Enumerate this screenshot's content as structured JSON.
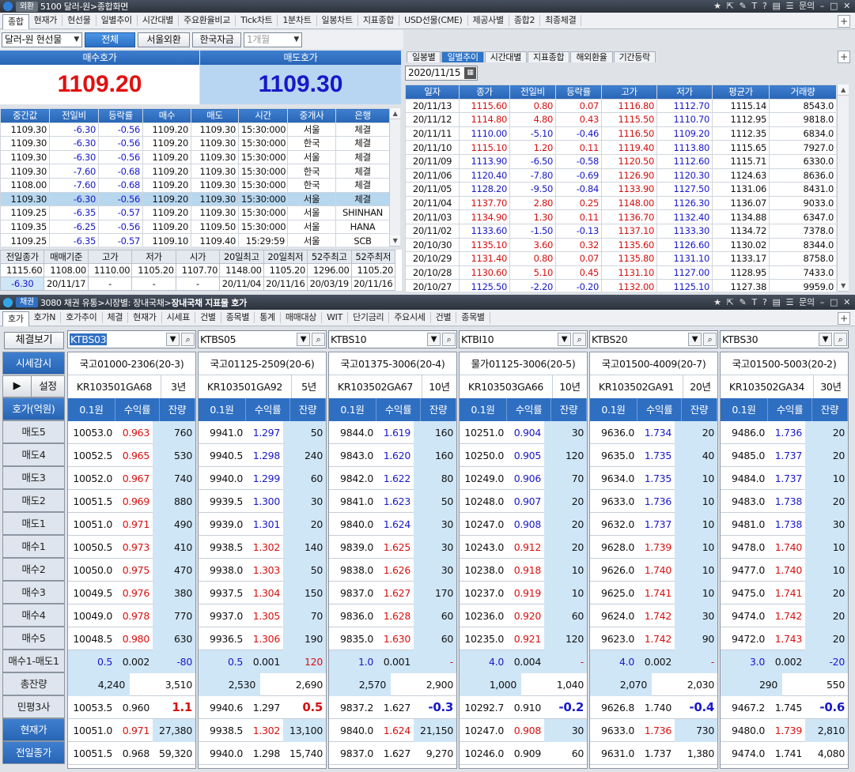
{
  "fx_window": {
    "badge": "외환",
    "title": "5100 달러-원>종합화면",
    "controls": [
      "★",
      "⇱",
      "✎",
      "T",
      "?",
      "▤",
      "☰",
      "문의",
      "–",
      "□",
      "✕"
    ],
    "tabs": [
      "종합",
      "현재가",
      "현선물",
      "일별추이",
      "시간대별",
      "주요환율비교",
      "Tick차트",
      "1분차트",
      "일봉차트",
      "지표종합",
      "USD선물(CME)",
      "제공사별",
      "종합2",
      "최종체결"
    ],
    "active_tab": 0,
    "instrument": "달러-원 현선물",
    "filters": [
      "전체",
      "서울외환",
      "한국자금"
    ],
    "period": "1개월",
    "bid_label": "매수호가",
    "ask_label": "매도호가",
    "bid_value": "1109.20",
    "ask_value": "1109.30",
    "tick_headers": [
      "중간값",
      "전일비",
      "등락률",
      "매수",
      "매도",
      "시간",
      "중개사",
      "은행"
    ],
    "ticks": [
      [
        "1109.30",
        "-6.30",
        "-0.56",
        "1109.20",
        "1109.30",
        "15:30:000",
        "서울",
        "체결"
      ],
      [
        "1109.30",
        "-6.30",
        "-0.56",
        "1109.20",
        "1109.30",
        "15:30:000",
        "한국",
        "체결"
      ],
      [
        "1109.30",
        "-6.30",
        "-0.56",
        "1109.20",
        "1109.30",
        "15:30:000",
        "서울",
        "체결"
      ],
      [
        "1109.30",
        "-7.60",
        "-0.68",
        "1109.20",
        "1109.30",
        "15:30:000",
        "한국",
        "체결"
      ],
      [
        "1108.00",
        "-7.60",
        "-0.68",
        "1109.20",
        "1109.30",
        "15:30:000",
        "한국",
        "체결"
      ],
      [
        "1109.30",
        "-6.30",
        "-0.56",
        "1109.20",
        "1109.30",
        "15:30:000",
        "서울",
        "체결"
      ],
      [
        "1109.25",
        "-6.35",
        "-0.57",
        "1109.20",
        "1109.30",
        "15:30:000",
        "서울",
        "SHINHAN"
      ],
      [
        "1109.35",
        "-6.25",
        "-0.56",
        "1109.20",
        "1109.50",
        "15:30:000",
        "서울",
        "HANA"
      ],
      [
        "1109.25",
        "-6.35",
        "-0.57",
        "1109.10",
        "1109.40",
        "15:29:59",
        "서울",
        "SCB"
      ]
    ],
    "summary_headers": [
      "전일종가",
      "매매기준",
      "고가",
      "저가",
      "시가",
      "20일최고",
      "20일최저",
      "52주최고",
      "52주최저"
    ],
    "summary_row1": [
      "1115.60",
      "1108.00",
      "1110.00",
      "1105.20",
      "1107.70",
      "1148.00",
      "1105.20",
      "1296.00",
      "1105.20"
    ],
    "summary_row2": [
      "-6.30",
      "20/11/17",
      "-",
      "-",
      "-",
      "20/11/04",
      "20/11/16",
      "20/03/19",
      "20/11/16"
    ],
    "right_tabs": [
      "일봉별",
      "일별추이",
      "시간대별",
      "지표종합",
      "해외환율",
      "기간등락"
    ],
    "right_active": 1,
    "date": "2020/11/15",
    "daily_headers": [
      "일자",
      "종가",
      "전일비",
      "등락률",
      "고가",
      "저가",
      "평균가",
      "거래량"
    ],
    "daily": [
      [
        "20/11/13",
        "1115.60",
        "0.80",
        "0.07",
        "1116.80",
        "1112.70",
        "1115.14",
        "8543.0"
      ],
      [
        "20/11/12",
        "1114.80",
        "4.80",
        "0.43",
        "1115.50",
        "1110.70",
        "1112.95",
        "9818.0"
      ],
      [
        "20/11/11",
        "1110.00",
        "-5.10",
        "-0.46",
        "1116.50",
        "1109.20",
        "1112.35",
        "6834.0"
      ],
      [
        "20/11/10",
        "1115.10",
        "1.20",
        "0.11",
        "1119.40",
        "1113.80",
        "1115.65",
        "7927.0"
      ],
      [
        "20/11/09",
        "1113.90",
        "-6.50",
        "-0.58",
        "1120.50",
        "1112.60",
        "1115.71",
        "6330.0"
      ],
      [
        "20/11/06",
        "1120.40",
        "-7.80",
        "-0.69",
        "1126.90",
        "1120.30",
        "1124.63",
        "8636.0"
      ],
      [
        "20/11/05",
        "1128.20",
        "-9.50",
        "-0.84",
        "1133.90",
        "1127.50",
        "1131.06",
        "8431.0"
      ],
      [
        "20/11/04",
        "1137.70",
        "2.80",
        "0.25",
        "1148.00",
        "1126.30",
        "1136.07",
        "9033.0"
      ],
      [
        "20/11/03",
        "1134.90",
        "1.30",
        "0.11",
        "1136.70",
        "1132.40",
        "1134.88",
        "6347.0"
      ],
      [
        "20/11/02",
        "1133.60",
        "-1.50",
        "-0.13",
        "1137.10",
        "1133.30",
        "1134.72",
        "7378.0"
      ],
      [
        "20/10/30",
        "1135.10",
        "3.60",
        "0.32",
        "1135.60",
        "1126.60",
        "1130.02",
        "8344.0"
      ],
      [
        "20/10/29",
        "1131.40",
        "0.80",
        "0.07",
        "1135.80",
        "1131.10",
        "1133.17",
        "8758.0"
      ],
      [
        "20/10/28",
        "1130.60",
        "5.10",
        "0.45",
        "1131.10",
        "1127.00",
        "1128.95",
        "7433.0"
      ],
      [
        "20/10/27",
        "1125.50",
        "-2.20",
        "-0.20",
        "1132.00",
        "1125.10",
        "1127.38",
        "9959.0"
      ]
    ]
  },
  "bond_window": {
    "badge": "채권",
    "title_plain": "3080 채권 유통>시장별: 장내국채>",
    "title_bold": "장내국채 지표물 호가",
    "tabs": [
      "호가",
      "호가N",
      "호가추이",
      "체결",
      "현재가",
      "시세표",
      "건별",
      "종목별",
      "통계",
      "매매대상",
      "WIT",
      "단기금리",
      "주요시세",
      "건별",
      "종목별"
    ],
    "active_tab": 0,
    "view_button": "체결보기",
    "monitor_label": "시세감시",
    "play_label": "▶",
    "settings_label": "설정",
    "unit_label": "호가(억원)",
    "col_headers": [
      "0.1원",
      "수익률",
      "잔량"
    ],
    "row_labels": [
      "매도5",
      "매도4",
      "매도3",
      "매도2",
      "매도1",
      "매수1",
      "매수2",
      "매수3",
      "매수4",
      "매수5"
    ],
    "diff_label": "매수1-매도1",
    "total_label": "총잔량",
    "private_label": "민평3사",
    "current_label": "현재가",
    "prev_label": "전일종가",
    "panels": [
      {
        "code": "KTBS03",
        "name": "국고01000-2306(20-3)",
        "isin": "KR103501GA68",
        "term": "3년",
        "rows": [
          [
            "10053.0",
            "0.963",
            "760"
          ],
          [
            "10052.5",
            "0.965",
            "530"
          ],
          [
            "10052.0",
            "0.967",
            "740"
          ],
          [
            "10051.5",
            "0.969",
            "880"
          ],
          [
            "10051.0",
            "0.971",
            "490"
          ],
          [
            "10050.5",
            "0.973",
            "410"
          ],
          [
            "10050.0",
            "0.975",
            "470"
          ],
          [
            "10049.5",
            "0.976",
            "380"
          ],
          [
            "10049.0",
            "0.978",
            "770"
          ],
          [
            "10048.5",
            "0.980",
            "630"
          ]
        ],
        "diff": [
          "0.5",
          "0.002",
          "-80"
        ],
        "total": [
          "4,240",
          "3,510"
        ],
        "private": [
          "10053.5",
          "0.960",
          "1.1"
        ],
        "current": [
          "10051.0",
          "0.971",
          "27,380"
        ],
        "prev": [
          "10051.5",
          "0.968",
          "59,320"
        ]
      },
      {
        "code": "KTBS05",
        "name": "국고01125-2509(20-6)",
        "isin": "KR103501GA92",
        "term": "5년",
        "rows": [
          [
            "9941.0",
            "1.297",
            "50"
          ],
          [
            "9940.5",
            "1.298",
            "240"
          ],
          [
            "9940.0",
            "1.299",
            "60"
          ],
          [
            "9939.5",
            "1.300",
            "30"
          ],
          [
            "9939.0",
            "1.301",
            "20"
          ],
          [
            "9938.5",
            "1.302",
            "140"
          ],
          [
            "9938.0",
            "1.303",
            "50"
          ],
          [
            "9937.5",
            "1.304",
            "150"
          ],
          [
            "9937.0",
            "1.305",
            "70"
          ],
          [
            "9936.5",
            "1.306",
            "190"
          ]
        ],
        "diff": [
          "0.5",
          "0.001",
          "120"
        ],
        "total": [
          "2,530",
          "2,690"
        ],
        "private": [
          "9940.6",
          "1.297",
          "0.5"
        ],
        "current": [
          "9938.5",
          "1.302",
          "13,100"
        ],
        "prev": [
          "9940.0",
          "1.298",
          "15,740"
        ]
      },
      {
        "code": "KTBS10",
        "name": "국고01375-3006(20-4)",
        "isin": "KR103502GA67",
        "term": "10년",
        "rows": [
          [
            "9844.0",
            "1.619",
            "160"
          ],
          [
            "9843.0",
            "1.620",
            "160"
          ],
          [
            "9842.0",
            "1.622",
            "80"
          ],
          [
            "9841.0",
            "1.623",
            "50"
          ],
          [
            "9840.0",
            "1.624",
            "30"
          ],
          [
            "9839.0",
            "1.625",
            "30"
          ],
          [
            "9838.0",
            "1.626",
            "30"
          ],
          [
            "9837.0",
            "1.627",
            "170"
          ],
          [
            "9836.0",
            "1.628",
            "60"
          ],
          [
            "9835.0",
            "1.630",
            "60"
          ]
        ],
        "diff": [
          "1.0",
          "0.001",
          "-"
        ],
        "total": [
          "2,570",
          "2,900"
        ],
        "private": [
          "9837.2",
          "1.627",
          "-0.3"
        ],
        "current": [
          "9840.0",
          "1.624",
          "21,150"
        ],
        "prev": [
          "9837.0",
          "1.627",
          "9,270"
        ]
      },
      {
        "code": "KTBI10",
        "name": "물가01125-3006(20-5)",
        "isin": "KR103503GA66",
        "term": "10년",
        "rows": [
          [
            "10251.0",
            "0.904",
            "30"
          ],
          [
            "10250.0",
            "0.905",
            "120"
          ],
          [
            "10249.0",
            "0.906",
            "70"
          ],
          [
            "10248.0",
            "0.907",
            "20"
          ],
          [
            "10247.0",
            "0.908",
            "20"
          ],
          [
            "10243.0",
            "0.912",
            "20"
          ],
          [
            "10238.0",
            "0.918",
            "10"
          ],
          [
            "10237.0",
            "0.919",
            "10"
          ],
          [
            "10236.0",
            "0.920",
            "60"
          ],
          [
            "10235.0",
            "0.921",
            "120"
          ]
        ],
        "diff": [
          "4.0",
          "0.004",
          "-"
        ],
        "total": [
          "1,000",
          "1,040"
        ],
        "private": [
          "10292.7",
          "0.910",
          "-0.2"
        ],
        "current": [
          "10247.0",
          "0.908",
          "30"
        ],
        "prev": [
          "10246.0",
          "0.909",
          "60"
        ]
      },
      {
        "code": "KTBS20",
        "name": "국고01500-4009(20-7)",
        "isin": "KR103502GA91",
        "term": "20년",
        "rows": [
          [
            "9636.0",
            "1.734",
            "20"
          ],
          [
            "9635.0",
            "1.735",
            "40"
          ],
          [
            "9634.0",
            "1.735",
            "10"
          ],
          [
            "9633.0",
            "1.736",
            "10"
          ],
          [
            "9632.0",
            "1.737",
            "10"
          ],
          [
            "9628.0",
            "1.739",
            "10"
          ],
          [
            "9626.0",
            "1.740",
            "10"
          ],
          [
            "9625.0",
            "1.741",
            "10"
          ],
          [
            "9624.0",
            "1.742",
            "30"
          ],
          [
            "9623.0",
            "1.742",
            "90"
          ]
        ],
        "diff": [
          "4.0",
          "0.002",
          "-"
        ],
        "total": [
          "2,070",
          "2,030"
        ],
        "private": [
          "9626.8",
          "1.740",
          "-0.4"
        ],
        "current": [
          "9633.0",
          "1.736",
          "730"
        ],
        "prev": [
          "9631.0",
          "1.737",
          "1,380"
        ]
      },
      {
        "code": "KTBS30",
        "name": "국고01500-5003(20-2)",
        "isin": "KR103502GA34",
        "term": "30년",
        "rows": [
          [
            "9486.0",
            "1.736",
            "20"
          ],
          [
            "9485.0",
            "1.737",
            "20"
          ],
          [
            "9484.0",
            "1.737",
            "10"
          ],
          [
            "9483.0",
            "1.738",
            "20"
          ],
          [
            "9481.0",
            "1.738",
            "30"
          ],
          [
            "9478.0",
            "1.740",
            "10"
          ],
          [
            "9477.0",
            "1.740",
            "10"
          ],
          [
            "9475.0",
            "1.741",
            "20"
          ],
          [
            "9474.0",
            "1.742",
            "20"
          ],
          [
            "9472.0",
            "1.743",
            "20"
          ]
        ],
        "diff": [
          "3.0",
          "0.002",
          "-20"
        ],
        "total": [
          "290",
          "550"
        ],
        "private": [
          "9467.2",
          "1.745",
          "-0.6"
        ],
        "current": [
          "9480.0",
          "1.739",
          "2,810"
        ],
        "prev": [
          "9474.0",
          "1.741",
          "4,080"
        ]
      }
    ]
  },
  "colors": {
    "header_blue": "#2f6fc2",
    "up_red": "#d61010",
    "down_blue": "#1818c8",
    "highlight": "#cfe6f7"
  }
}
